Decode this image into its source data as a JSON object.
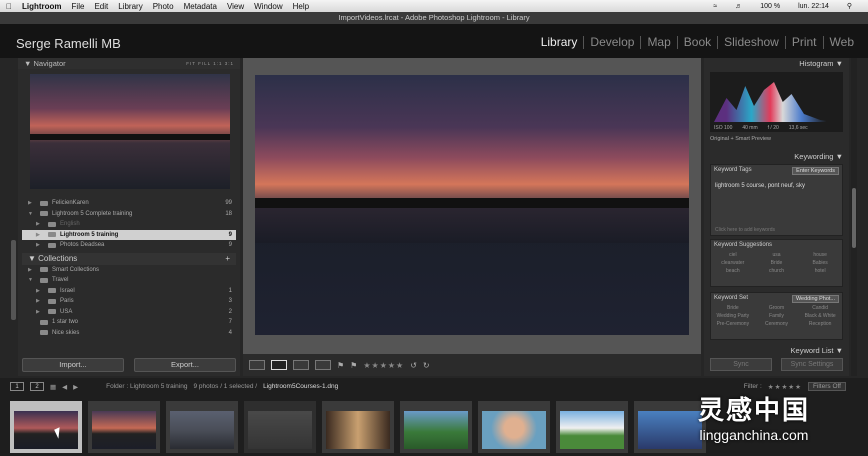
{
  "menubar": {
    "apple": "",
    "app": "Lightroom",
    "items": [
      "File",
      "Edit",
      "Library",
      "Photo",
      "Metadata",
      "View",
      "Window",
      "Help"
    ],
    "status": {
      "battery": "100 %",
      "time": "lun. 22:14"
    }
  },
  "window": {
    "title": "ImportVideos.lrcat - Adobe Photoshop Lightroom - Library"
  },
  "identity": {
    "plate": "Serge Ramelli MB"
  },
  "modules": [
    "Library",
    "Develop",
    "Map",
    "Book",
    "Slideshow",
    "Print",
    "Web"
  ],
  "navigator": {
    "title": "Navigator",
    "options": "FIT  FILL  1:1  3:1"
  },
  "folders": [
    {
      "label": "FelicienKaren",
      "count": "99",
      "state": "normal"
    },
    {
      "label": "Lightroom 5 Complete training",
      "count": "18",
      "state": "normal"
    },
    {
      "label": "English",
      "count": "",
      "state": "dim"
    },
    {
      "label": "Lightroom 5 training",
      "count": "9",
      "state": "selected"
    },
    {
      "label": "Photos Deadsea",
      "count": "9",
      "state": "normal"
    }
  ],
  "collections": {
    "title": "Collections",
    "plus": "+",
    "items": [
      {
        "label": "Smart Collections",
        "count": ""
      },
      {
        "label": "Travel",
        "count": ""
      },
      {
        "label": "Israel",
        "count": "1"
      },
      {
        "label": "Paris",
        "count": "3"
      },
      {
        "label": "USA",
        "count": "2"
      },
      {
        "label": "1 star two",
        "count": "7"
      },
      {
        "label": "Nice skies",
        "count": "4"
      }
    ]
  },
  "buttons": {
    "import": "Import...",
    "export": "Export..."
  },
  "histogram": {
    "title": "Histogram",
    "iso": "ISO 100",
    "focal": "40 mm",
    "aperture": "f / 20",
    "shutter": "13,6 sec",
    "note": "Original + Smart Preview"
  },
  "keywording": {
    "title": "Keywording",
    "tags_label": "Keyword Tags",
    "tags_select": "Enter Keywords",
    "tags_text": "lightroom 5 course, pont neuf, sky",
    "hint": "Click here to add keywords",
    "suggestions_label": "Keyword Suggestions",
    "suggestions": [
      "ciel",
      "usa",
      "house",
      "clearwater",
      "Bride",
      "Babies",
      "beach",
      "church",
      "hotel"
    ],
    "set_label": "Keyword Set",
    "set_select": "Wedding Phot...",
    "set_items": [
      "Bride",
      "Groom",
      "Candid",
      "Wedding Party",
      "Family",
      "Black & White",
      "Pre-Ceremony",
      "Ceremony",
      "Reception"
    ],
    "list": "Keyword List",
    "sync": "Sync",
    "sync_settings": "Sync Settings"
  },
  "filmstrip": {
    "pages": [
      "1",
      "2"
    ],
    "source": "Folder : Lightroom 5 training",
    "count": "9 photos / 1 selected /",
    "file": "Lightroom5Courses-1.dng",
    "filter_label": "Filter :",
    "filter_select": "Filters Off"
  },
  "watermark": {
    "cn": "灵感中国",
    "url": "lingganchina.com"
  },
  "colors": {
    "accent": "#d0d0d0",
    "background": "#262626"
  }
}
